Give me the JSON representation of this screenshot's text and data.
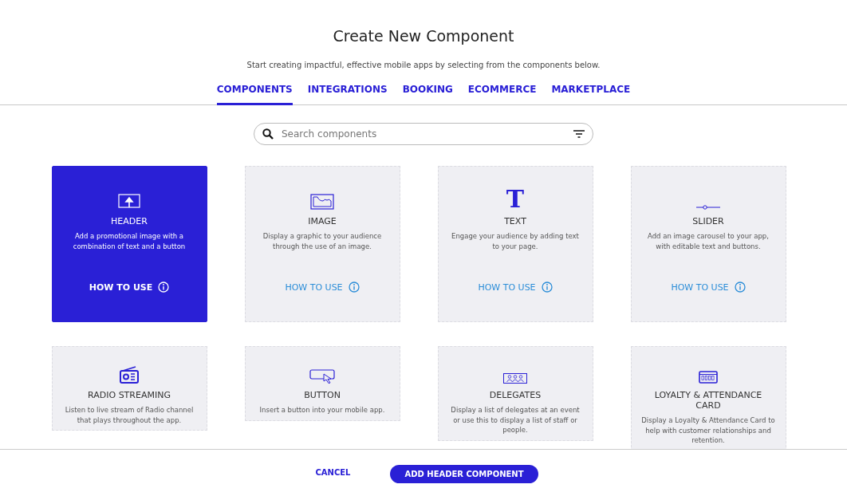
{
  "title": "Create New Component",
  "subtitle": "Start creating impactful, effective mobile apps by selecting from the components below.",
  "tabs": [
    {
      "label": "COMPONENTS",
      "selected": true
    },
    {
      "label": "INTEGRATIONS",
      "selected": false
    },
    {
      "label": "BOOKING",
      "selected": false
    },
    {
      "label": "ECOMMERCE",
      "selected": false
    },
    {
      "label": "MARKETPLACE",
      "selected": false
    }
  ],
  "search": {
    "placeholder": "Search components"
  },
  "cards": [
    {
      "kind": "header",
      "title": "HEADER",
      "description": "Add a promotional image with a combination of text and a button",
      "link": "HOW TO USE",
      "selected": true
    },
    {
      "kind": "image",
      "title": "IMAGE",
      "description": "Display a graphic to your audience through the use of an image.",
      "link": "HOW TO USE",
      "selected": false
    },
    {
      "kind": "text",
      "icon_glyph": "T",
      "title": "TEXT",
      "description": "Engage your audience by adding text to your page.",
      "link": "HOW TO USE",
      "selected": false
    },
    {
      "kind": "slider",
      "title": "SLIDER",
      "description": "Add an image carousel to your app, with editable text and buttons.",
      "link": "HOW TO USE",
      "selected": false
    },
    {
      "kind": "radio",
      "title": "RADIO STREAMING",
      "description": "Listen to live stream of Radio channel that plays throughout the app.",
      "selected": false
    },
    {
      "kind": "button",
      "title": "BUTTON",
      "description": "Insert a button into your mobile app.",
      "selected": false
    },
    {
      "kind": "delegates",
      "title": "DELEGATES",
      "description": "Display a list of delegates at an event or use this to display a list of staff or people.",
      "selected": false
    },
    {
      "kind": "loyalty",
      "title": "LOYALTY & ATTENDANCE CARD",
      "description": "Display a Loyalty & Attendance Card to help with customer relationships and retention.",
      "selected": false
    }
  ],
  "footer": {
    "cancel": "CANCEL",
    "confirm": "ADD HEADER COMPONENT"
  }
}
